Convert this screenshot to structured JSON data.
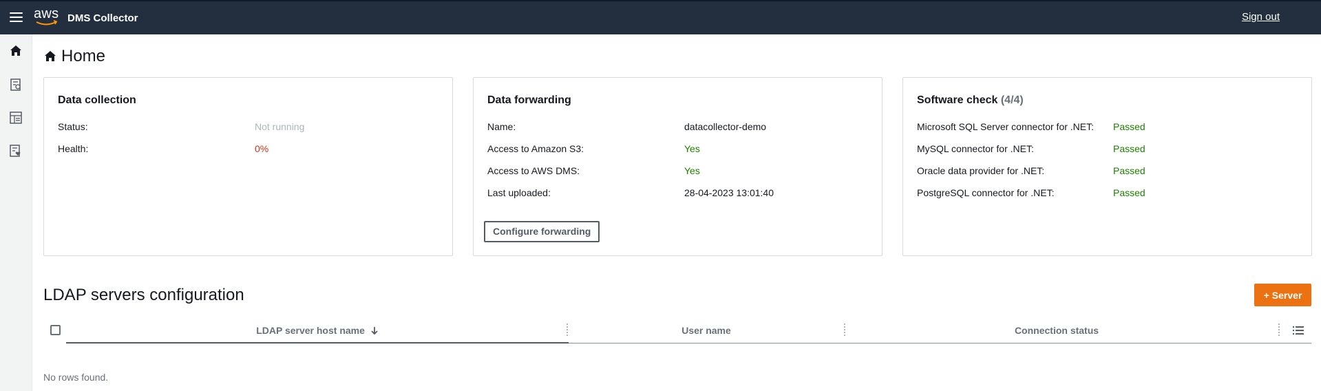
{
  "topbar": {
    "logo_text": "aws",
    "app_title": "DMS Collector",
    "signout_label": "Sign out"
  },
  "sidenav": {
    "items": [
      {
        "icon": "home-icon"
      },
      {
        "icon": "servers-icon"
      },
      {
        "icon": "database-list-icon"
      },
      {
        "icon": "health-check-icon"
      }
    ]
  },
  "page": {
    "title": "Home"
  },
  "cards": {
    "data_collection": {
      "title": "Data collection",
      "status_label": "Status:",
      "status_value": "Not running",
      "health_label": "Health:",
      "health_value": "0%"
    },
    "data_forwarding": {
      "title": "Data forwarding",
      "name_label": "Name:",
      "name_value": "datacollector-demo",
      "s3_label": "Access to Amazon S3:",
      "s3_value": "Yes",
      "dms_label": "Access to AWS DMS:",
      "dms_value": "Yes",
      "uploaded_label": "Last uploaded:",
      "uploaded_value": "28-04-2023 13:01:40",
      "configure_button": "Configure forwarding"
    },
    "software_check": {
      "title": "Software check",
      "count": "(4/4)",
      "items": [
        {
          "label": "Microsoft SQL Server connector for .NET:",
          "value": "Passed"
        },
        {
          "label": "MySQL connector for .NET:",
          "value": "Passed"
        },
        {
          "label": "Oracle data provider for .NET:",
          "value": "Passed"
        },
        {
          "label": "PostgreSQL connector for .NET:",
          "value": "Passed"
        }
      ]
    }
  },
  "ldap": {
    "title": "LDAP servers configuration",
    "add_button": "Server",
    "columns": [
      "LDAP server host name",
      "User name",
      "Connection status"
    ],
    "empty_text": "No rows found."
  },
  "colors": {
    "header_bg": "#232f3e",
    "accent_orange": "#ec7211",
    "success_green": "#1d8102",
    "error_red": "#d13212"
  }
}
